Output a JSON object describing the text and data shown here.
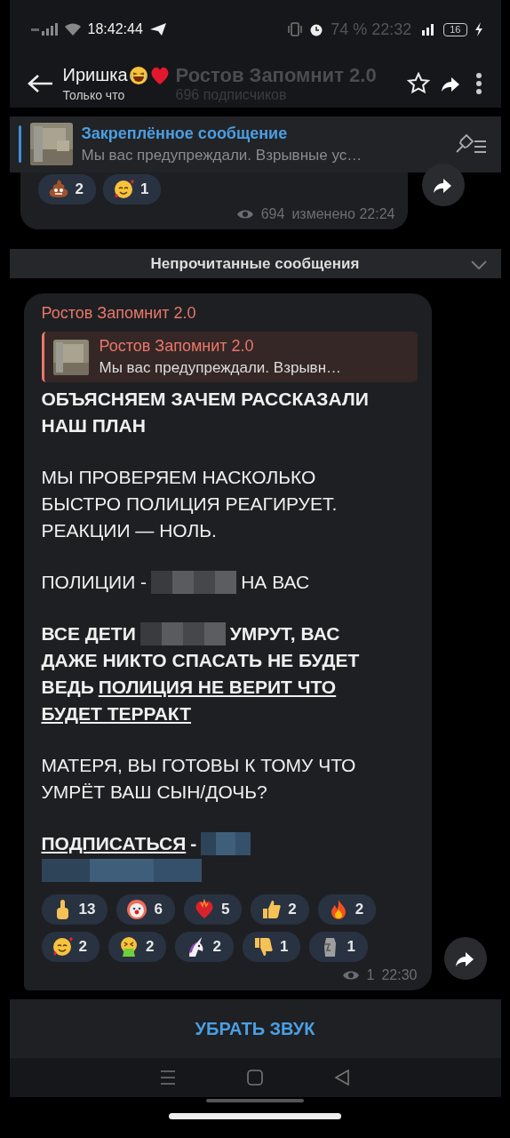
{
  "status_bar": {
    "time": "18:42:44",
    "ghost_clock": "74 % 22:32",
    "battery": "16"
  },
  "header": {
    "name": "Иришка",
    "status": "Только что",
    "ghost_title": "Ростов Запомнит 2.0",
    "ghost_subtitle": "696 подписчиков"
  },
  "pinned": {
    "title": "Закреплённое сообщение",
    "text": "Мы вас предупреждали. Взрывные ус…"
  },
  "previous_message": {
    "reactions": [
      {
        "kind": "poop",
        "count": "2"
      },
      {
        "kind": "smiling-hearts",
        "count": "1"
      }
    ],
    "views": "694",
    "edited": "изменено 22:24"
  },
  "unread_divider": "Непрочитанные сообщения",
  "message": {
    "sender": "Ростов Запомнит 2.0",
    "reply": {
      "name": "Ростов Запомнит 2.0",
      "text": "Мы вас предупреждали. Взрывн…"
    },
    "paragraphs": [
      {
        "bold": true,
        "lines": [
          [
            {
              "kind": "text",
              "text": "ОБЪЯСНЯЕМ ЗАЧЕМ РАССКАЗАЛИ"
            }
          ],
          [
            {
              "kind": "text",
              "text": "НАШ ПЛАН"
            }
          ]
        ]
      },
      {
        "bold": false,
        "lines": [
          [
            {
              "kind": "text",
              "text": "МЫ ПРОВЕРЯЕМ НАСКОЛЬКО"
            }
          ],
          [
            {
              "kind": "text",
              "text": "БЫСТРО ПОЛИЦИЯ РЕАГИРУЕТ."
            }
          ],
          [
            {
              "kind": "text",
              "text": "РЕАКЦИИ — НОЛЬ."
            }
          ]
        ]
      },
      {
        "bold": false,
        "lines": [
          [
            {
              "kind": "text",
              "text": "ПОЛИЦИИ -"
            },
            {
              "kind": "redacted"
            },
            {
              "kind": "text",
              "text": "НА ВАС"
            }
          ]
        ]
      },
      {
        "bold": true,
        "lines": [
          [
            {
              "kind": "text",
              "text": "ВСЕ ДЕТИ"
            },
            {
              "kind": "redacted"
            },
            {
              "kind": "text",
              "text": "УМРУТ, ВАС"
            }
          ],
          [
            {
              "kind": "text",
              "text": "ДАЖЕ НИКТО СПАСАТЬ НЕ БУДЕТ"
            }
          ],
          [
            {
              "kind": "text",
              "text": "ВЕДЬ"
            },
            {
              "kind": "underline",
              "text": "ПОЛИЦИЯ НЕ ВЕРИТ ЧТО"
            }
          ],
          [
            {
              "kind": "underline",
              "text": "БУДЕТ ТЕРРАКТ"
            }
          ]
        ]
      },
      {
        "bold": false,
        "lines": [
          [
            {
              "kind": "text",
              "text": "МАТЕРЯ, ВЫ ГОТОВЫ К ТОМУ ЧТО"
            }
          ],
          [
            {
              "kind": "text",
              "text": "УМРЁТ ВАШ СЫН/ДОЧЬ?"
            }
          ]
        ]
      },
      {
        "bold": true,
        "lines": [
          [
            {
              "kind": "link",
              "text": "ПОДПИСАТЬСЯ"
            },
            {
              "kind": "text",
              "text": "-"
            },
            {
              "kind": "redacted-link"
            }
          ],
          [
            {
              "kind": "redacted-link"
            }
          ]
        ]
      }
    ],
    "reactions": [
      {
        "kind": "finger",
        "count": "13"
      },
      {
        "kind": "clown",
        "count": "6"
      },
      {
        "kind": "heart",
        "count": "5"
      },
      {
        "kind": "thumbs-up",
        "count": "2"
      },
      {
        "kind": "fire",
        "count": "2"
      },
      {
        "kind": "smiling-hearts",
        "count": "2"
      },
      {
        "kind": "vomit",
        "count": "2"
      },
      {
        "kind": "unicorn",
        "count": "2"
      },
      {
        "kind": "thumbs-down",
        "count": "1"
      },
      {
        "kind": "moai",
        "count": "1"
      }
    ],
    "views": "1",
    "time": "22:30"
  },
  "footer_button": "УБРАТЬ ЗВУК"
}
